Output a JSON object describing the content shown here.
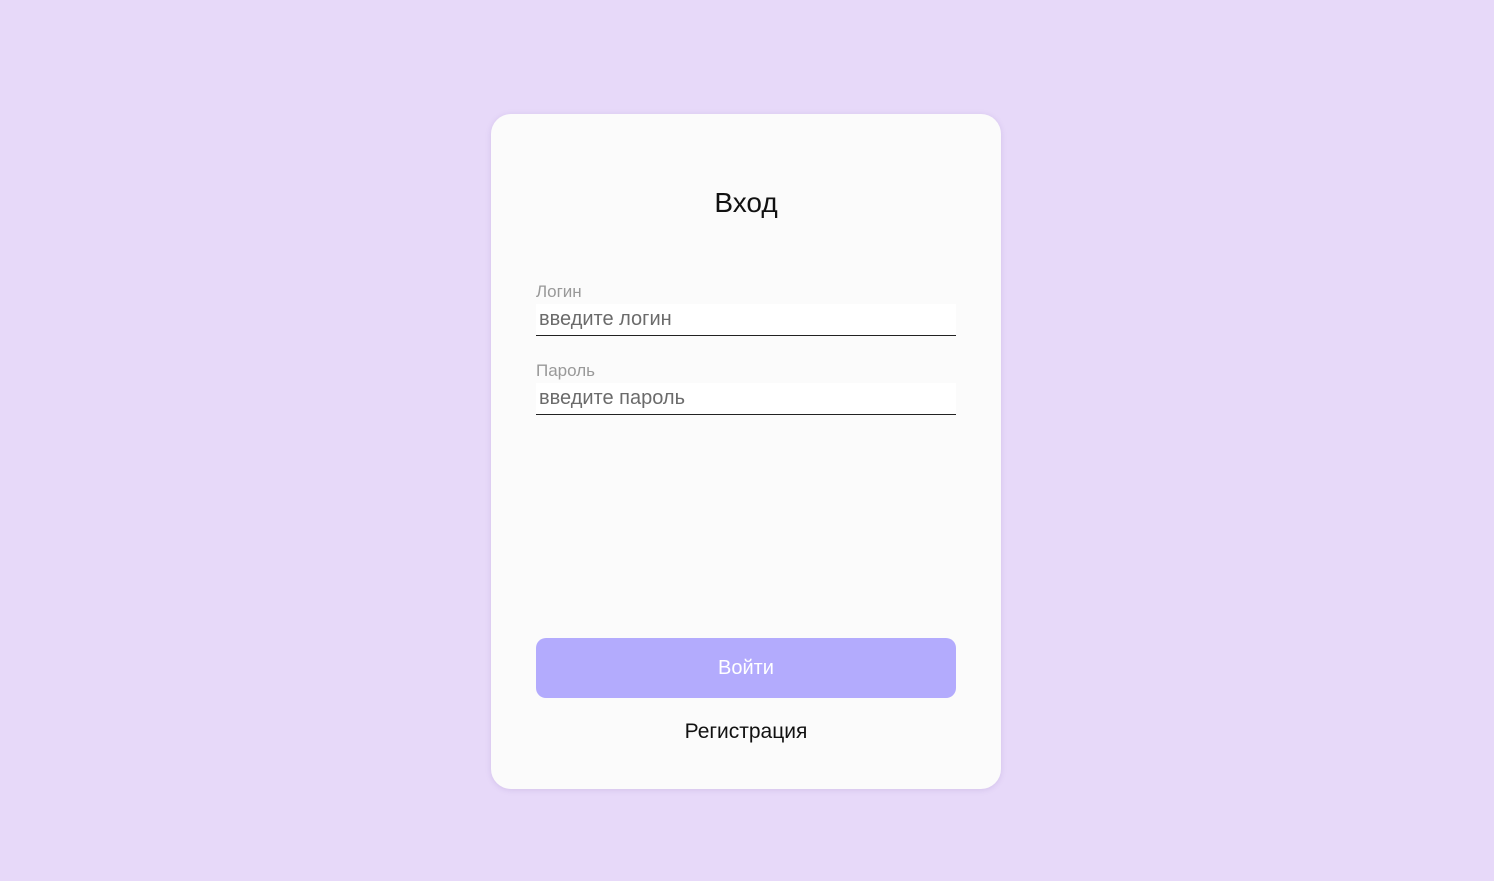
{
  "form": {
    "title": "Вход",
    "login": {
      "label": "Логин",
      "placeholder": "введите логин",
      "value": ""
    },
    "password": {
      "label": "Пароль",
      "placeholder": "введите пароль",
      "value": ""
    },
    "submit_label": "Войти",
    "register_label": "Регистрация"
  },
  "colors": {
    "background": "#e7d9f9",
    "card": "#fbfbfb",
    "button": "#b3abfd",
    "button_text": "#ffffff"
  }
}
